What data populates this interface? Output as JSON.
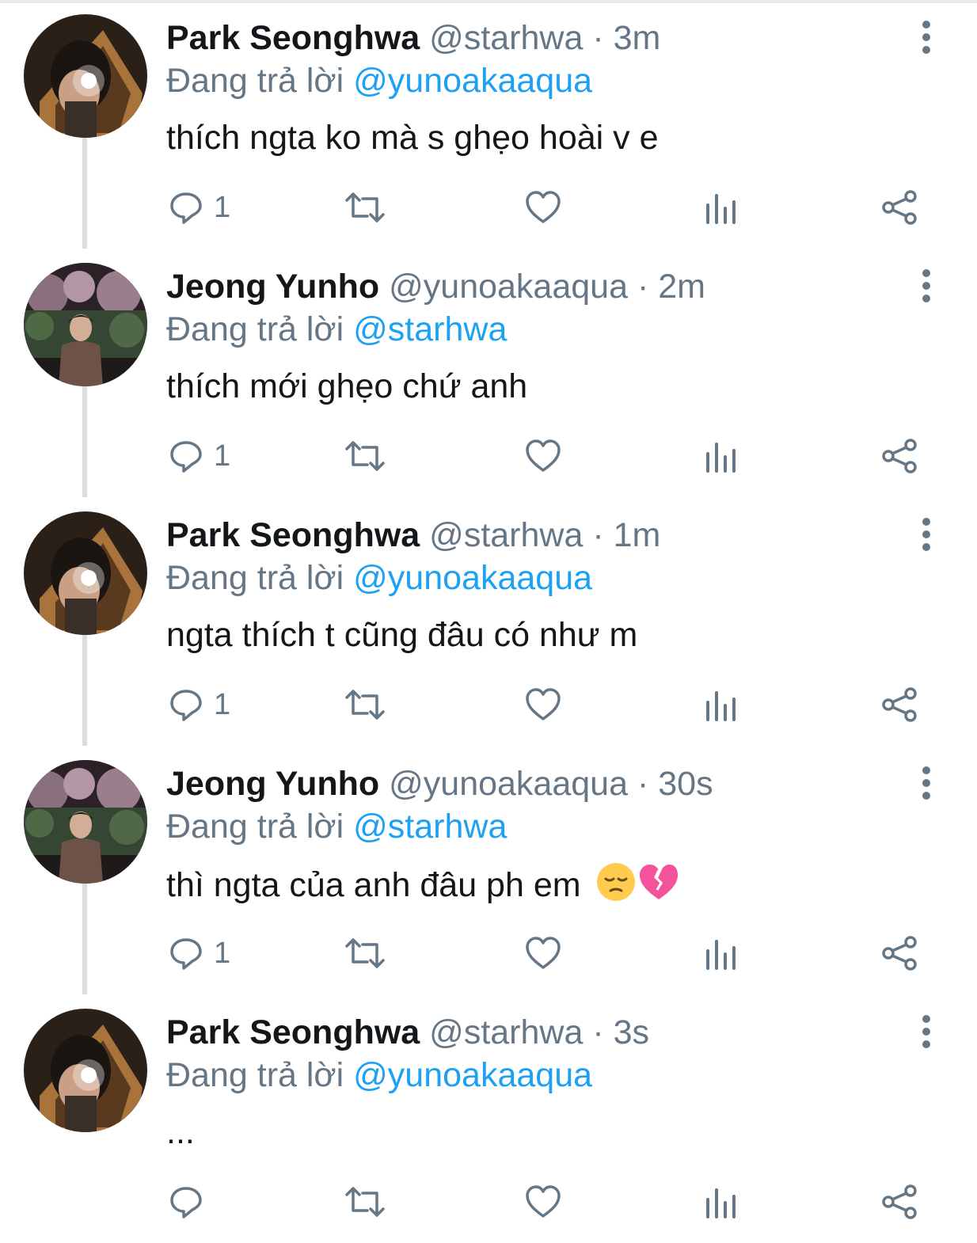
{
  "colors": {
    "text": "#14171a",
    "muted": "#657786",
    "link": "#1da1f2",
    "thread_line": "#d9dde0"
  },
  "tweets": [
    {
      "name": "Park Seonghwa",
      "handle": "@starhwa",
      "separator": "·",
      "time": "3m",
      "reply_prefix": "Đang trả lời",
      "reply_to": "@yunoakaaqua",
      "text": "thích ngta ko mà s ghẹo hoài v e",
      "reply_count": "1",
      "avatar": "avatar-seonghwa"
    },
    {
      "name": "Jeong Yunho",
      "handle": "@yunoakaaqua",
      "separator": "·",
      "time": "2m",
      "reply_prefix": "Đang trả lời",
      "reply_to": "@starhwa",
      "text": "thích mới ghẹo chứ anh",
      "reply_count": "1",
      "avatar": "avatar-yunho"
    },
    {
      "name": "Park Seonghwa",
      "handle": "@starhwa",
      "separator": "·",
      "time": "1m",
      "reply_prefix": "Đang trả lời",
      "reply_to": "@yunoakaaqua",
      "text": "ngta thích t cũng đâu có như m",
      "reply_count": "1",
      "avatar": "avatar-seonghwa"
    },
    {
      "name": "Jeong Yunho",
      "handle": "@yunoakaaqua",
      "separator": "·",
      "time": "30s",
      "reply_prefix": "Đang trả lời",
      "reply_to": "@starhwa",
      "text": "thì ngta của anh đâu ph em",
      "emojis": [
        "pensive-face-emoji",
        "broken-heart-emoji"
      ],
      "reply_count": "1",
      "avatar": "avatar-yunho"
    },
    {
      "name": "Park Seonghwa",
      "handle": "@starhwa",
      "separator": "·",
      "time": "3s",
      "reply_prefix": "Đang trả lời",
      "reply_to": "@yunoakaaqua",
      "text": "...",
      "reply_count": "",
      "avatar": "avatar-seonghwa"
    }
  ],
  "icons": {
    "reply": "reply-icon",
    "retweet": "retweet-icon",
    "like": "heart-icon",
    "analytics": "analytics-icon",
    "share": "share-icon",
    "more": "more-vertical-icon"
  }
}
